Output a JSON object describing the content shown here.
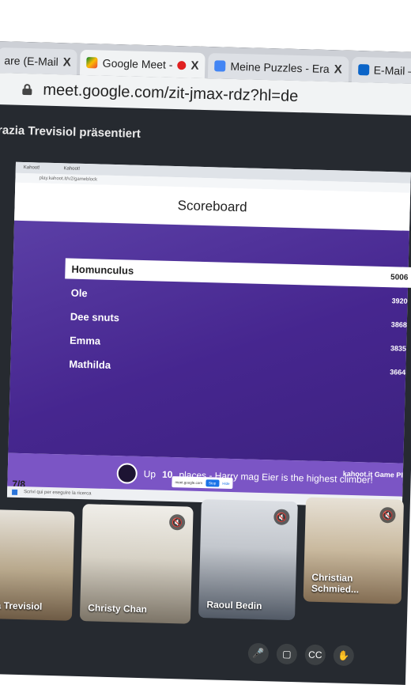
{
  "browser": {
    "tabs": [
      {
        "label": "are (E-Mail",
        "close": "X"
      },
      {
        "label": "Google Meet -",
        "close": "X",
        "recording": true
      },
      {
        "label": "Meine Puzzles - Era",
        "close": "X"
      },
      {
        "label": "E-Mail – Christian S",
        "close": "X"
      }
    ],
    "url": "meet.google.com/zit-jmax-rdz?hl=de"
  },
  "meet": {
    "presenter_label": "razia Trevisiol präsentiert",
    "participants": [
      {
        "name": "ia Trevisiol",
        "muted": false
      },
      {
        "name": "Christy Chan",
        "muted": true
      },
      {
        "name": "Raoul Bedin",
        "muted": true
      },
      {
        "name": "Christian Schmied...",
        "muted": true
      }
    ],
    "meeting_code": "zit-jmax-rdz",
    "controls": {
      "mic": "mic-icon",
      "camera": "camera-icon",
      "captions": "CC",
      "raise_hand": "hand-icon"
    }
  },
  "slide": {
    "inner_tabs": [
      "Kahoot!",
      "Kahoot!"
    ],
    "title": "Scoreboard",
    "leaderboard": [
      {
        "name": "Homunculus",
        "score": "5006"
      },
      {
        "name": "Ole",
        "score": "3920"
      },
      {
        "name": "Dee snuts",
        "score": "3868"
      },
      {
        "name": "Emma",
        "score": "3835"
      },
      {
        "name": "Mathilda",
        "score": "3664"
      }
    ],
    "climber_prefix": "Up",
    "climber_places": "10",
    "climber_suffix": "places - Harry mag Eier is the highest climber!",
    "brand": "kahoot.it Game PI",
    "page": "7/8",
    "taskbar_search": "Scrivi qui per eseguire la ricerca"
  },
  "colors": {
    "accent": "#5b3fa6",
    "climber_bar": "#7b55c5",
    "meet_bg": "#262a30"
  }
}
